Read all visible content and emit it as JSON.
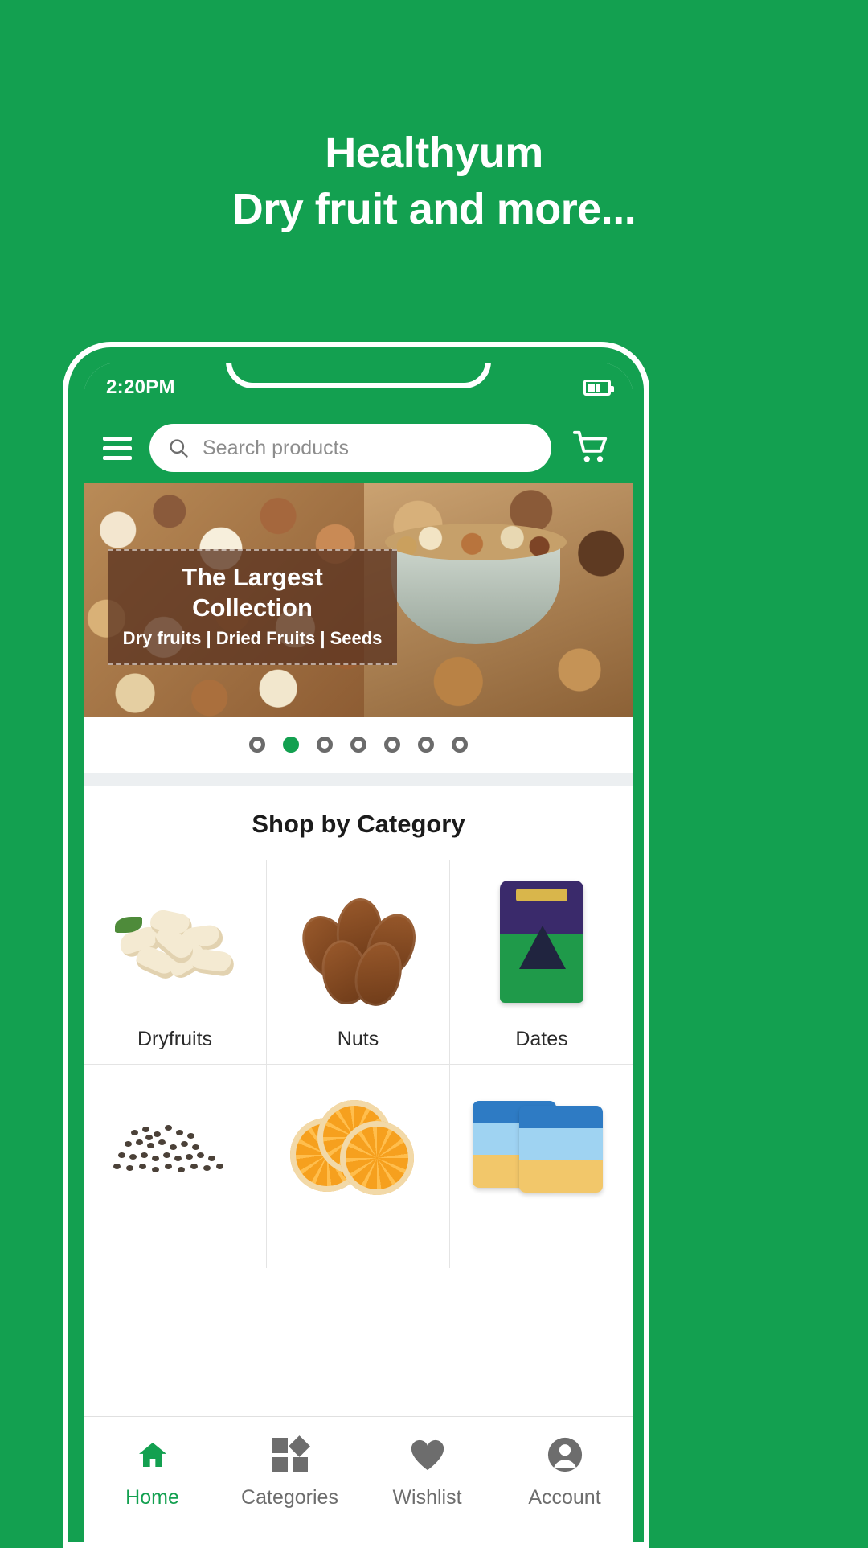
{
  "promo": {
    "line1": "Healthyum",
    "line2": "Dry fruit and more..."
  },
  "colors": {
    "brand_green": "#13a050",
    "accent_green": "#0f9a4a",
    "inactive_gray": "#6d6d6d"
  },
  "status_bar": {
    "time": "2:20PM",
    "battery_icon": "battery-icon"
  },
  "app_bar": {
    "menu_icon": "hamburger-menu-icon",
    "search_icon": "search-icon",
    "search_placeholder": "Search products",
    "search_value": "",
    "cart_icon": "shopping-cart-icon"
  },
  "banner": {
    "title": "The Largest Collection",
    "subtitle": "Dry fruits | Dried Fruits | Seeds",
    "dots_total": 7,
    "dots_active_index": 1
  },
  "section": {
    "title": "Shop by Category"
  },
  "categories": [
    {
      "label": "Dryfruits",
      "icon": "cashews-image"
    },
    {
      "label": "Nuts",
      "icon": "pecans-image"
    },
    {
      "label": "Dates",
      "icon": "date-crown-pack-image"
    },
    {
      "label": "",
      "icon": "chia-seeds-image"
    },
    {
      "label": "",
      "icon": "dried-orange-slices-image"
    },
    {
      "label": "",
      "icon": "kuch-kuch-pack-image"
    }
  ],
  "bottom_nav": [
    {
      "label": "Home",
      "icon": "home-icon",
      "active": true
    },
    {
      "label": "Categories",
      "icon": "grid-icon",
      "active": false
    },
    {
      "label": "Wishlist",
      "icon": "heart-icon",
      "active": false
    },
    {
      "label": "Account",
      "icon": "account-icon",
      "active": false
    }
  ]
}
